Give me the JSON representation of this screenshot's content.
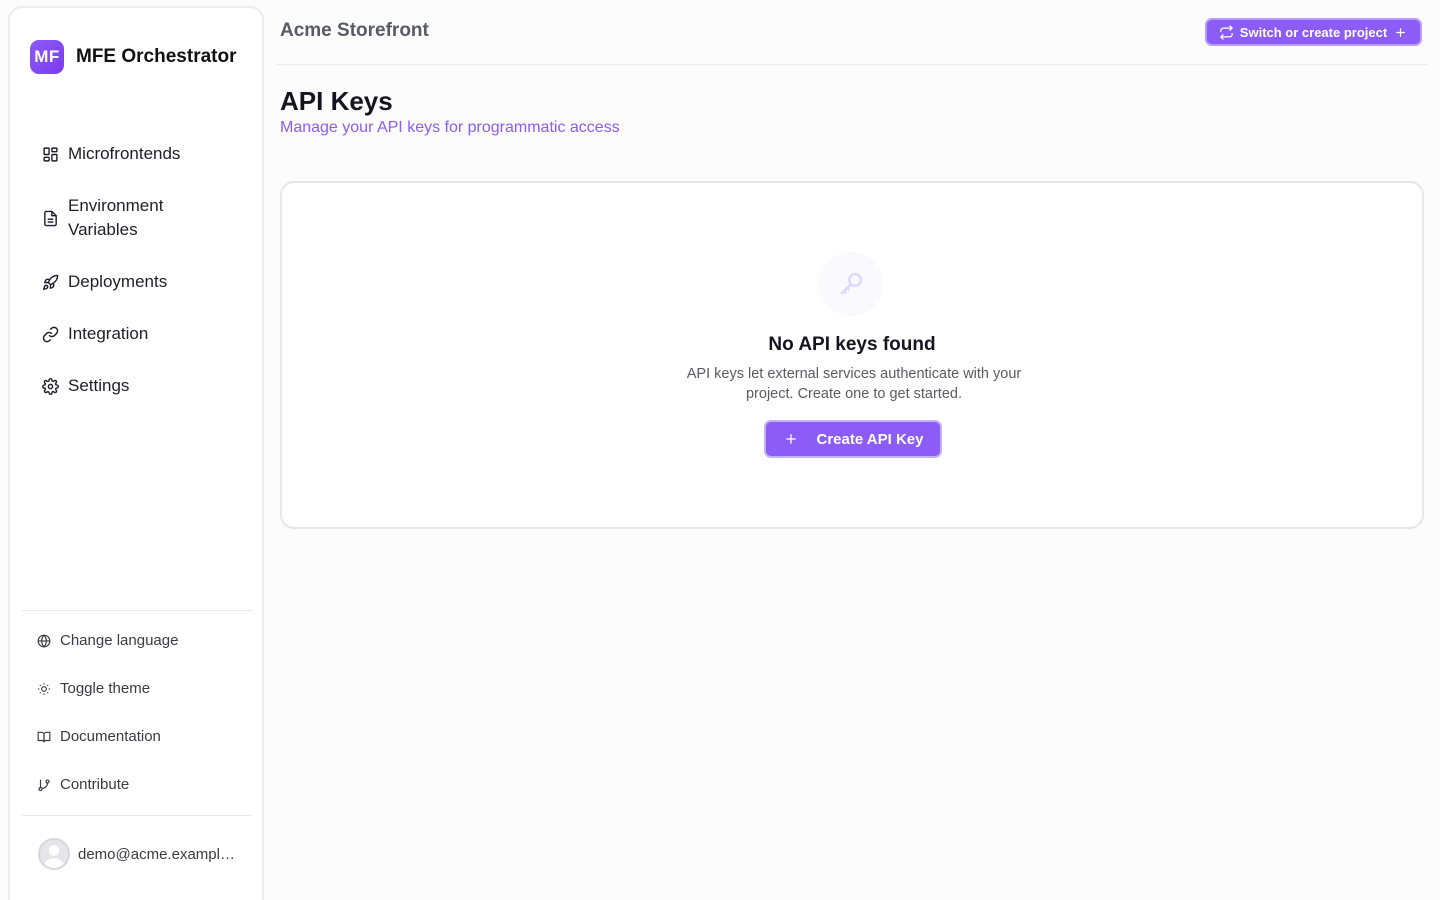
{
  "brand": {
    "logo_text": "MF",
    "name": "MFE Orchestrator"
  },
  "nav": {
    "items": [
      {
        "label": "Microfrontends",
        "icon": "grid-icon"
      },
      {
        "label": "Environment Variables",
        "icon": "file-text-icon"
      },
      {
        "label": "Deployments",
        "icon": "rocket-icon"
      },
      {
        "label": "Integration",
        "icon": "link-icon"
      },
      {
        "label": "Settings",
        "icon": "gear-icon"
      }
    ]
  },
  "utilities": {
    "items": [
      {
        "label": "Change language",
        "icon": "globe-icon"
      },
      {
        "label": "Toggle theme",
        "icon": "sun-icon"
      },
      {
        "label": "Documentation",
        "icon": "book-icon"
      },
      {
        "label": "Contribute",
        "icon": "git-branch-icon"
      }
    ]
  },
  "user": {
    "email": "demo@acme.example.com"
  },
  "header": {
    "project_name": "Acme Storefront",
    "switch_label": "Switch or create project"
  },
  "page": {
    "title": "API Keys",
    "subtitle": "Manage your API keys for programmatic access"
  },
  "empty_state": {
    "icon": "key-icon",
    "title": "No API keys found",
    "description": "API keys let external services authenticate with your project. Create one to get started.",
    "button_label": "Create API Key"
  },
  "colors": {
    "accent": "#8b5cf6",
    "border": "#e6e6ec"
  }
}
